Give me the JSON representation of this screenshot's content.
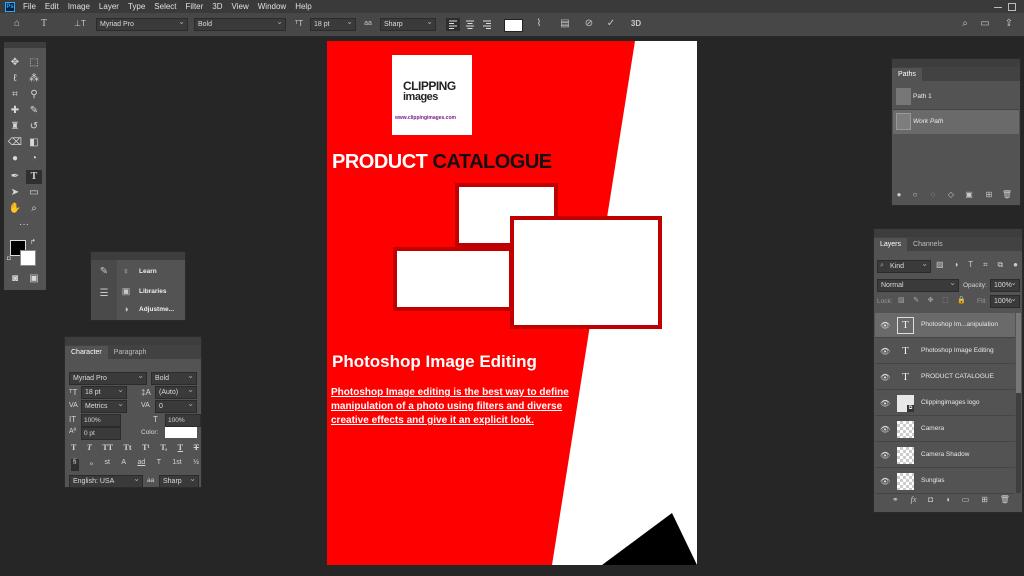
{
  "menu": [
    "File",
    "Edit",
    "Image",
    "Layer",
    "Type",
    "Select",
    "Filter",
    "3D",
    "View",
    "Window",
    "Help"
  ],
  "app_logo": "Ps",
  "options": {
    "font_family": "Myriad Pro",
    "font_style": "Bold",
    "font_size": "18 pt",
    "aa_prefix": "aa",
    "antialias": "Sharp",
    "threed": "3D",
    "swatch_color": "#ffffff"
  },
  "mini_panel": {
    "items": [
      {
        "label": "Learn",
        "icon": "bulb-icon"
      },
      {
        "label": "Libraries",
        "icon": "libraries-icon"
      },
      {
        "label": "Adjustme...",
        "icon": "adjustments-icon"
      }
    ]
  },
  "character": {
    "tabs": [
      "Character",
      "Paragraph"
    ],
    "font_family": "Myriad Pro",
    "font_style": "Bold",
    "size": "18 pt",
    "leading": "(Auto)",
    "kerning": "Metrics",
    "tracking": "0",
    "v_scale": "100%",
    "h_scale": "100%",
    "baseline": "0 pt",
    "color_label": "Color:",
    "style_buttons": [
      "T",
      "T",
      "TT",
      "Tt",
      "T¹",
      "T,",
      "T",
      "T"
    ],
    "ot_buttons": [
      "fi",
      "ℴ",
      "st",
      "A",
      "ad",
      "T",
      "1st",
      "½"
    ],
    "language": "English: USA",
    "antialias": "Sharp",
    "aa_label": "aa"
  },
  "paths": {
    "title": "Paths",
    "items": [
      "Path 1",
      "Work Path"
    ]
  },
  "layers": {
    "tabs": [
      "Layers",
      "Channels"
    ],
    "filter_label": "Kind",
    "blend_mode": "Normal",
    "opacity_label": "Opacity:",
    "opacity": "100%",
    "lock_label": "Lock:",
    "fill_label": "Fill:",
    "fill": "100%",
    "rows": [
      {
        "name": "Photoshop Im...anipulation",
        "kind": "text"
      },
      {
        "name": "Photoshop Image Editing",
        "kind": "text"
      },
      {
        "name": "PRODUCT CATALOGUE",
        "kind": "text"
      },
      {
        "name": "Clippingimages logo",
        "kind": "smart"
      },
      {
        "name": "Camera",
        "kind": "pixel"
      },
      {
        "name": "Camera  Shadow",
        "kind": "pixel"
      },
      {
        "name": "Sunglas",
        "kind": "pixel"
      }
    ],
    "footer_icons": [
      "link-icon",
      "fx-icon",
      "mask-icon",
      "adjustment-icon",
      "folder-icon",
      "new-layer-icon",
      "trash-icon"
    ]
  },
  "document": {
    "logo_line1": "CLIPPING",
    "logo_line2": "images",
    "logo_url": "www.clippingimages.com",
    "title_part1": "PRODUCT ",
    "title_part2": "CATALOGUE",
    "heading": "Photoshop Image Editing",
    "body_lines": [
      "Photoshop Image editing is the best way to define",
      "manipulation of a photo using filters and diverse",
      "creative effects and give it an explicit look."
    ],
    "colors": {
      "red": "#ff0000",
      "dark_red": "#c00000",
      "black": "#000000"
    }
  }
}
